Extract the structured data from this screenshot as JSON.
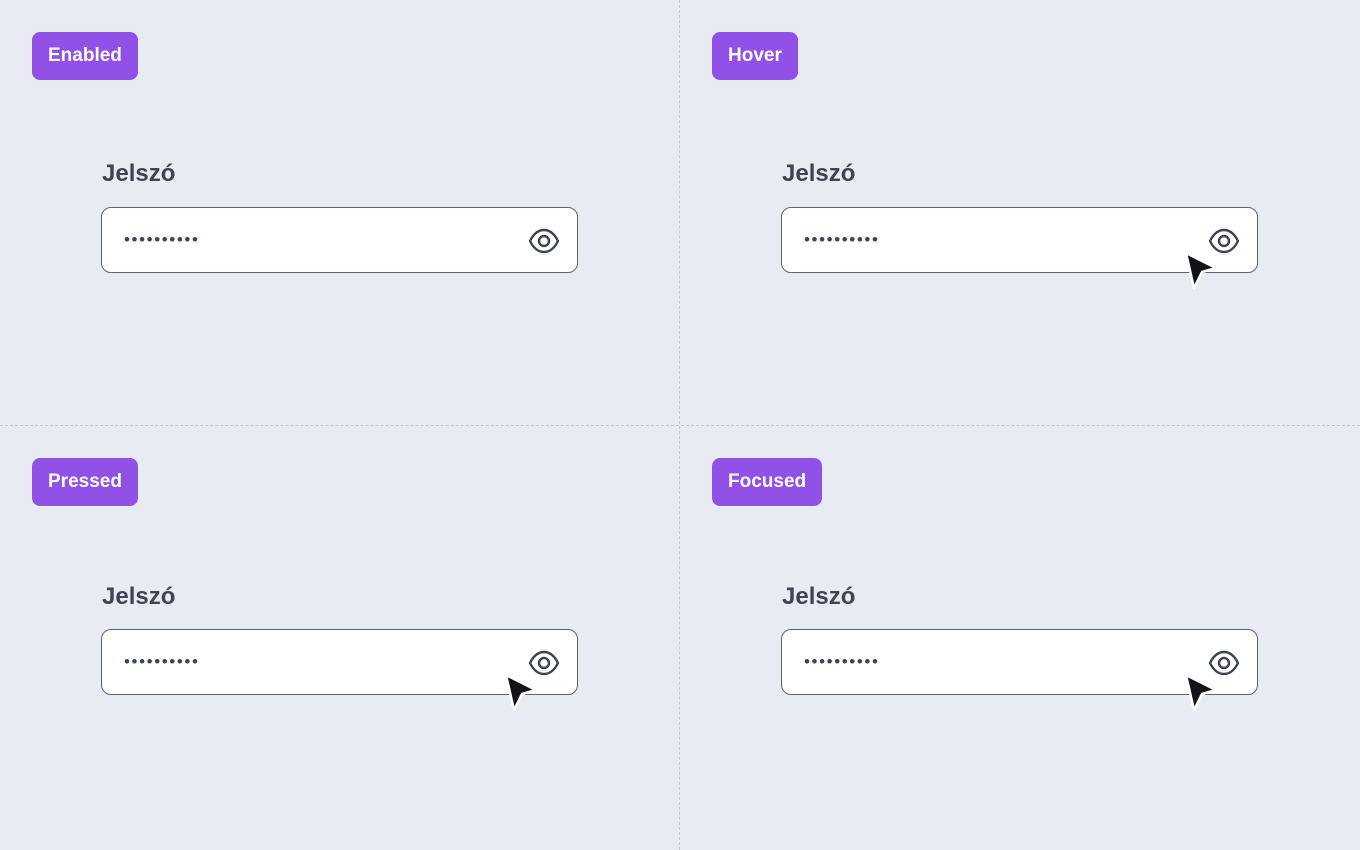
{
  "states": {
    "enabled": {
      "badge": "Enabled",
      "label": "Jelszó",
      "value": "••••••••••"
    },
    "hover": {
      "badge": "Hover",
      "label": "Jelszó",
      "value": "••••••••••"
    },
    "pressed": {
      "badge": "Pressed",
      "label": "Jelszó",
      "value": "••••••••••"
    },
    "focused": {
      "badge": "Focused",
      "label": "Jelszó",
      "value": "••••••••••"
    }
  },
  "icons": {
    "toggle": "eye-icon",
    "pointer": "mouse-cursor-icon"
  },
  "colors": {
    "background": "#e8ebf1",
    "badge": "#9150e6",
    "text": "#3d4453",
    "border": "#596274"
  }
}
